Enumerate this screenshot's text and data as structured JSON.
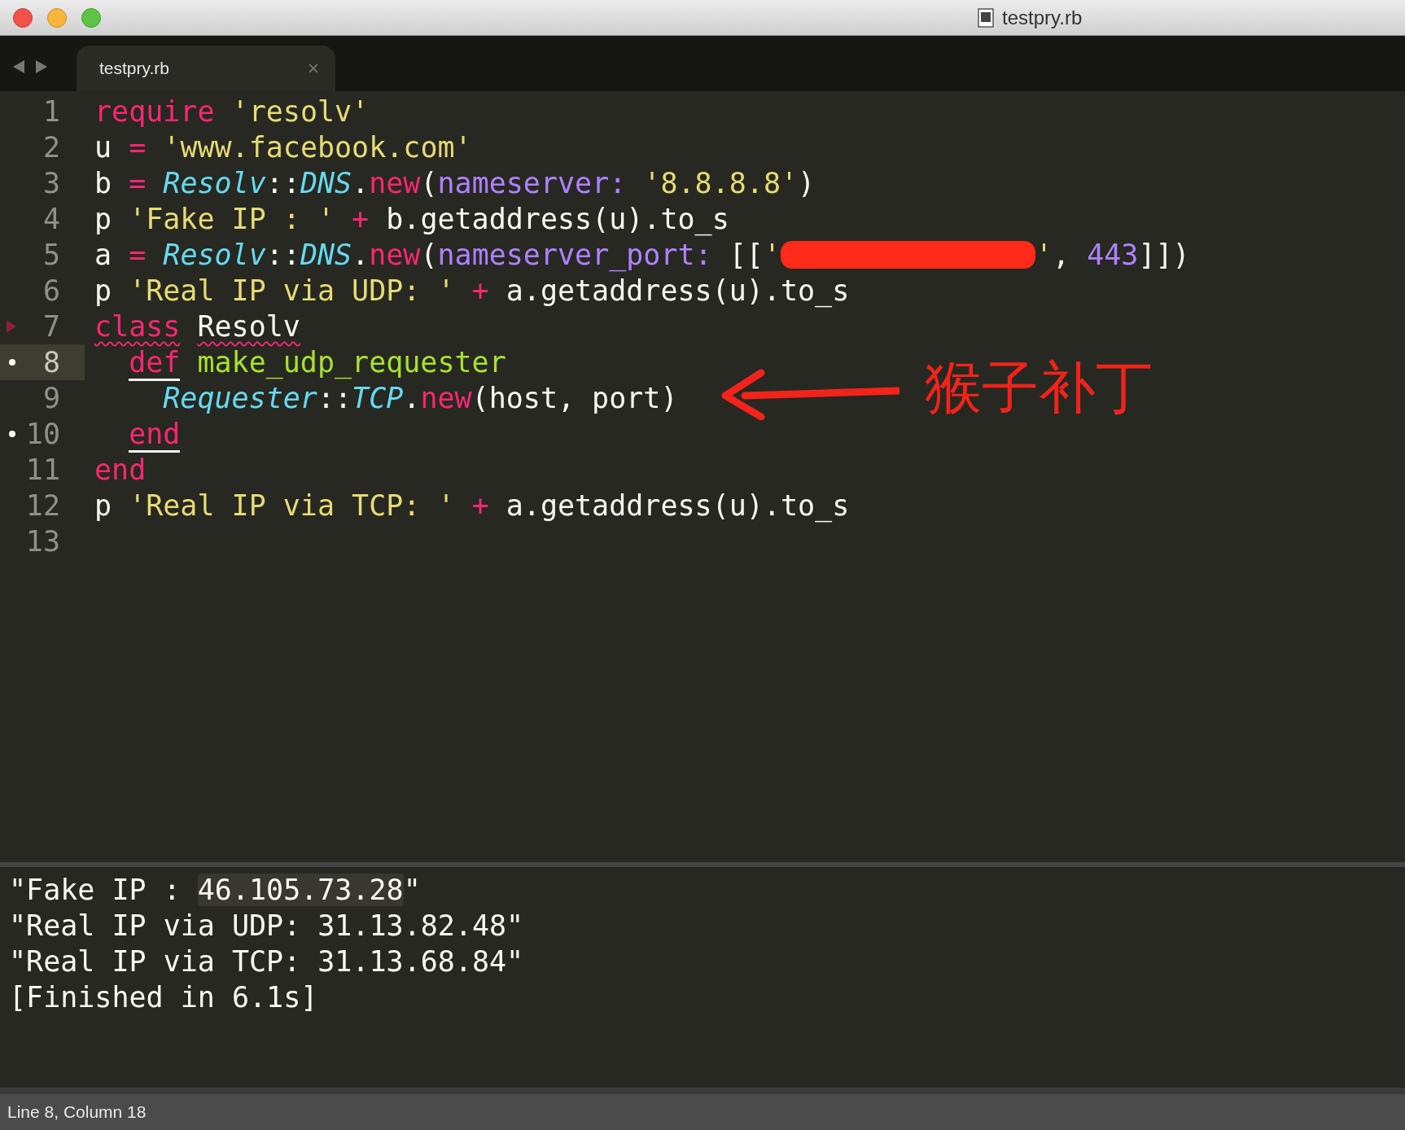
{
  "window": {
    "title": "testpry.rb"
  },
  "tabs": [
    {
      "label": "testpry.rb",
      "selected": true,
      "close": "×"
    }
  ],
  "editor": {
    "lines": [
      {
        "number": "1",
        "current": false,
        "fold_marker": false,
        "bookmark": false,
        "tokens": [
          {
            "kind": "keyword",
            "text": "require"
          },
          {
            "kind": "string",
            "text": " 'resolv'"
          }
        ]
      },
      {
        "number": "2",
        "current": false,
        "fold_marker": false,
        "bookmark": false,
        "tokens": [
          {
            "kind": "plain",
            "text": "u "
          },
          {
            "kind": "keyword",
            "text": "="
          },
          {
            "kind": "string",
            "text": " 'www.facebook.com'"
          }
        ]
      },
      {
        "number": "3",
        "current": false,
        "fold_marker": false,
        "bookmark": false,
        "tokens": [
          {
            "kind": "plain",
            "text": "b "
          },
          {
            "kind": "keyword",
            "text": "="
          },
          {
            "kind": "constant",
            "text": " Resolv"
          },
          {
            "kind": "plain",
            "text": "::"
          },
          {
            "kind": "constant",
            "text": "DNS"
          },
          {
            "kind": "plain",
            "text": "."
          },
          {
            "kind": "keyword",
            "text": "new"
          },
          {
            "kind": "plain",
            "text": "("
          },
          {
            "kind": "param",
            "text": "nameserver:"
          },
          {
            "kind": "string",
            "text": " '8.8.8.8'"
          },
          {
            "kind": "plain",
            "text": ")"
          }
        ]
      },
      {
        "number": "4",
        "current": false,
        "fold_marker": false,
        "bookmark": false,
        "tokens": [
          {
            "kind": "plain",
            "text": "p "
          },
          {
            "kind": "string",
            "text": "'Fake IP : '"
          },
          {
            "kind": "keyword",
            "text": " +"
          },
          {
            "kind": "plain",
            "text": " b.getaddress(u).to_s"
          }
        ]
      },
      {
        "number": "5",
        "current": false,
        "fold_marker": false,
        "bookmark": false,
        "tokens": [
          {
            "kind": "plain",
            "text": "a "
          },
          {
            "kind": "keyword",
            "text": "="
          },
          {
            "kind": "constant",
            "text": " Resolv"
          },
          {
            "kind": "plain",
            "text": "::"
          },
          {
            "kind": "constant",
            "text": "DNS"
          },
          {
            "kind": "plain",
            "text": "."
          },
          {
            "kind": "keyword",
            "text": "new"
          },
          {
            "kind": "plain",
            "text": "("
          },
          {
            "kind": "param",
            "text": "nameserver_port:"
          },
          {
            "kind": "plain",
            "text": " [["
          },
          {
            "kind": "string",
            "text": "'"
          },
          {
            "kind": "redaction"
          },
          {
            "kind": "string",
            "text": "'"
          },
          {
            "kind": "plain",
            "text": ", "
          },
          {
            "kind": "number",
            "text": "443"
          },
          {
            "kind": "plain",
            "text": "]])"
          }
        ]
      },
      {
        "number": "6",
        "current": false,
        "fold_marker": false,
        "bookmark": false,
        "tokens": [
          {
            "kind": "plain",
            "text": "p "
          },
          {
            "kind": "string",
            "text": "'Real IP via UDP: '"
          },
          {
            "kind": "keyword",
            "text": " +"
          },
          {
            "kind": "plain",
            "text": " a.getaddress(u).to_s"
          }
        ]
      },
      {
        "number": "7",
        "current": false,
        "fold_marker": true,
        "bookmark": false,
        "tokens": [
          {
            "kind": "keyword",
            "text": "class",
            "squiggly": true
          },
          {
            "kind": "plain",
            "text": " Resolv",
            "squiggly": true
          }
        ],
        "children": [
          {
            "number": "8",
            "current": true,
            "fold_marker": false,
            "bookmark": true,
            "tokens": [
              {
                "kind": "keyword",
                "text": "def",
                "bracket_match": true
              },
              {
                "kind": "func",
                "text": " make_udp_requester"
              }
            ],
            "children": [
              {
                "number": "9",
                "current": false,
                "fold_marker": false,
                "bookmark": false,
                "tokens": [
                  {
                    "kind": "constant",
                    "text": "Requester"
                  },
                  {
                    "kind": "plain",
                    "text": "::"
                  },
                  {
                    "kind": "constant",
                    "text": "TCP"
                  },
                  {
                    "kind": "plain",
                    "text": "."
                  },
                  {
                    "kind": "keyword",
                    "text": "new"
                  },
                  {
                    "kind": "plain",
                    "text": "(host, port)"
                  }
                ]
              }
            ]
          },
          {
            "number": "10",
            "current": false,
            "fold_marker": false,
            "bookmark": true,
            "tokens": [
              {
                "kind": "keyword",
                "text": "end",
                "bracket_match": true
              }
            ]
          }
        ]
      },
      {
        "number": "11",
        "current": false,
        "fold_marker": false,
        "bookmark": false,
        "tokens": [
          {
            "kind": "keyword",
            "text": "end"
          }
        ]
      },
      {
        "number": "12",
        "current": false,
        "fold_marker": false,
        "bookmark": false,
        "tokens": [
          {
            "kind": "plain",
            "text": "p "
          },
          {
            "kind": "string",
            "text": "'Real IP via TCP: '"
          },
          {
            "kind": "keyword",
            "text": " +"
          },
          {
            "kind": "plain",
            "text": " a.getaddress(u).to_s"
          }
        ]
      },
      {
        "number": "13",
        "current": false,
        "fold_marker": false,
        "bookmark": false
      }
    ],
    "annotation": {
      "text": "猴子补丁"
    }
  },
  "output": {
    "lines": [
      [
        {
          "text": "\"Fake IP : ",
          "highlighted": false
        },
        {
          "text": "46.105.73.28",
          "highlighted": true
        },
        {
          "text": "\"",
          "highlighted": false
        }
      ],
      [
        {
          "text": "\"Real IP via UDP: 31.13.82.48\"",
          "highlighted": false
        }
      ],
      [
        {
          "text": "\"Real IP via TCP: 31.13.68.84\"",
          "highlighted": false
        }
      ],
      [
        {
          "text": "[Finished in 6.1s]",
          "highlighted": false
        }
      ]
    ]
  },
  "status_bar": {
    "text": "Line 8, Column 18"
  }
}
